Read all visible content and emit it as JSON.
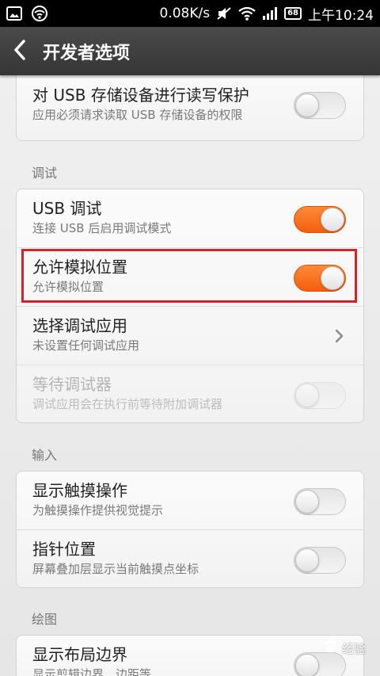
{
  "status_bar": {
    "speed": "0.08K/s",
    "battery": "68",
    "time": "上午10:24"
  },
  "action_bar": {
    "title": "开发者选项"
  },
  "sections": {
    "top": {
      "rows": [
        {
          "title": "对 USB 存储设备进行读写保护",
          "subtitle": "应用必须请求读取 USB 存储设备的权限",
          "toggle": "off"
        }
      ]
    },
    "debug": {
      "label": "调试",
      "rows": [
        {
          "title": "USB 调试",
          "subtitle": "连接 USB 后启用调试模式",
          "toggle": "on"
        },
        {
          "title": "允许模拟位置",
          "subtitle": "允许模拟位置",
          "toggle": "on"
        },
        {
          "title": "选择调试应用",
          "subtitle": "未设置任何调试应用",
          "toggle": "chevron"
        },
        {
          "title": "等待调试器",
          "subtitle": "调试应用会在执行前等待附加调试器",
          "toggle": "disabled"
        }
      ]
    },
    "input": {
      "label": "输入",
      "rows": [
        {
          "title": "显示触摸操作",
          "subtitle": "为触摸操作提供视觉提示",
          "toggle": "off"
        },
        {
          "title": "指针位置",
          "subtitle": "屏幕叠加层显示当前触摸点坐标",
          "toggle": "off"
        }
      ]
    },
    "drawing": {
      "label": "绘图",
      "rows": [
        {
          "title": "显示布局边界",
          "subtitle": "显示剪辑边界、边距等",
          "toggle": "off"
        }
      ]
    }
  },
  "watermark": "经验",
  "colors": {
    "accent": "#f26a1b",
    "highlight": "#d8202a"
  }
}
